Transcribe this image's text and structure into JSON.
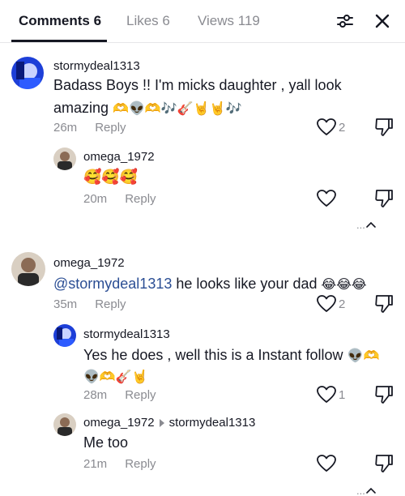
{
  "tabs": [
    {
      "label": "Comments 6"
    },
    {
      "label": "Likes 6"
    },
    {
      "label": "Views 119"
    }
  ],
  "comments": [
    {
      "username": "stormydeal1313",
      "line1": "Badass Boys !! I'm micks daughter , yall look",
      "line2": "amazing",
      "line2_emojis": "🫶👽🫶🎶🎸🤘🤘🎶",
      "time": "26m",
      "reply": "Reply",
      "likes": "2"
    },
    {
      "username": "omega_1972",
      "emojis": "🥰🥰🥰",
      "time": "20m",
      "reply": "Reply"
    },
    {
      "username": "omega_1972",
      "mention": "@stormydeal1313",
      "text": "he looks like your dad",
      "emojis": "😂😂😂",
      "time": "35m",
      "reply": "Reply",
      "likes": "2"
    },
    {
      "username": "stormydeal1313",
      "line1": "Yes he does , well this is a Instant follow",
      "line1_emojis": "👽🫶",
      "line2_emojis": "👽🫶🎸🤘",
      "time": "28m",
      "reply": "Reply",
      "likes": "1"
    },
    {
      "username": "omega_1972",
      "reply_to": "stormydeal1313",
      "text": "Me too",
      "time": "21m",
      "reply": "Reply"
    }
  ],
  "more_replies": "...",
  "colors": {
    "text": "#161823",
    "secondary": "#8a8b91",
    "mention": "#2b4e94",
    "divider": "#e6e6e9"
  },
  "icons": [
    "filter-sliders-icon",
    "close-icon",
    "heart-icon",
    "dislike-icon",
    "chevron-up-icon",
    "avatar-blue",
    "avatar-dark"
  ]
}
